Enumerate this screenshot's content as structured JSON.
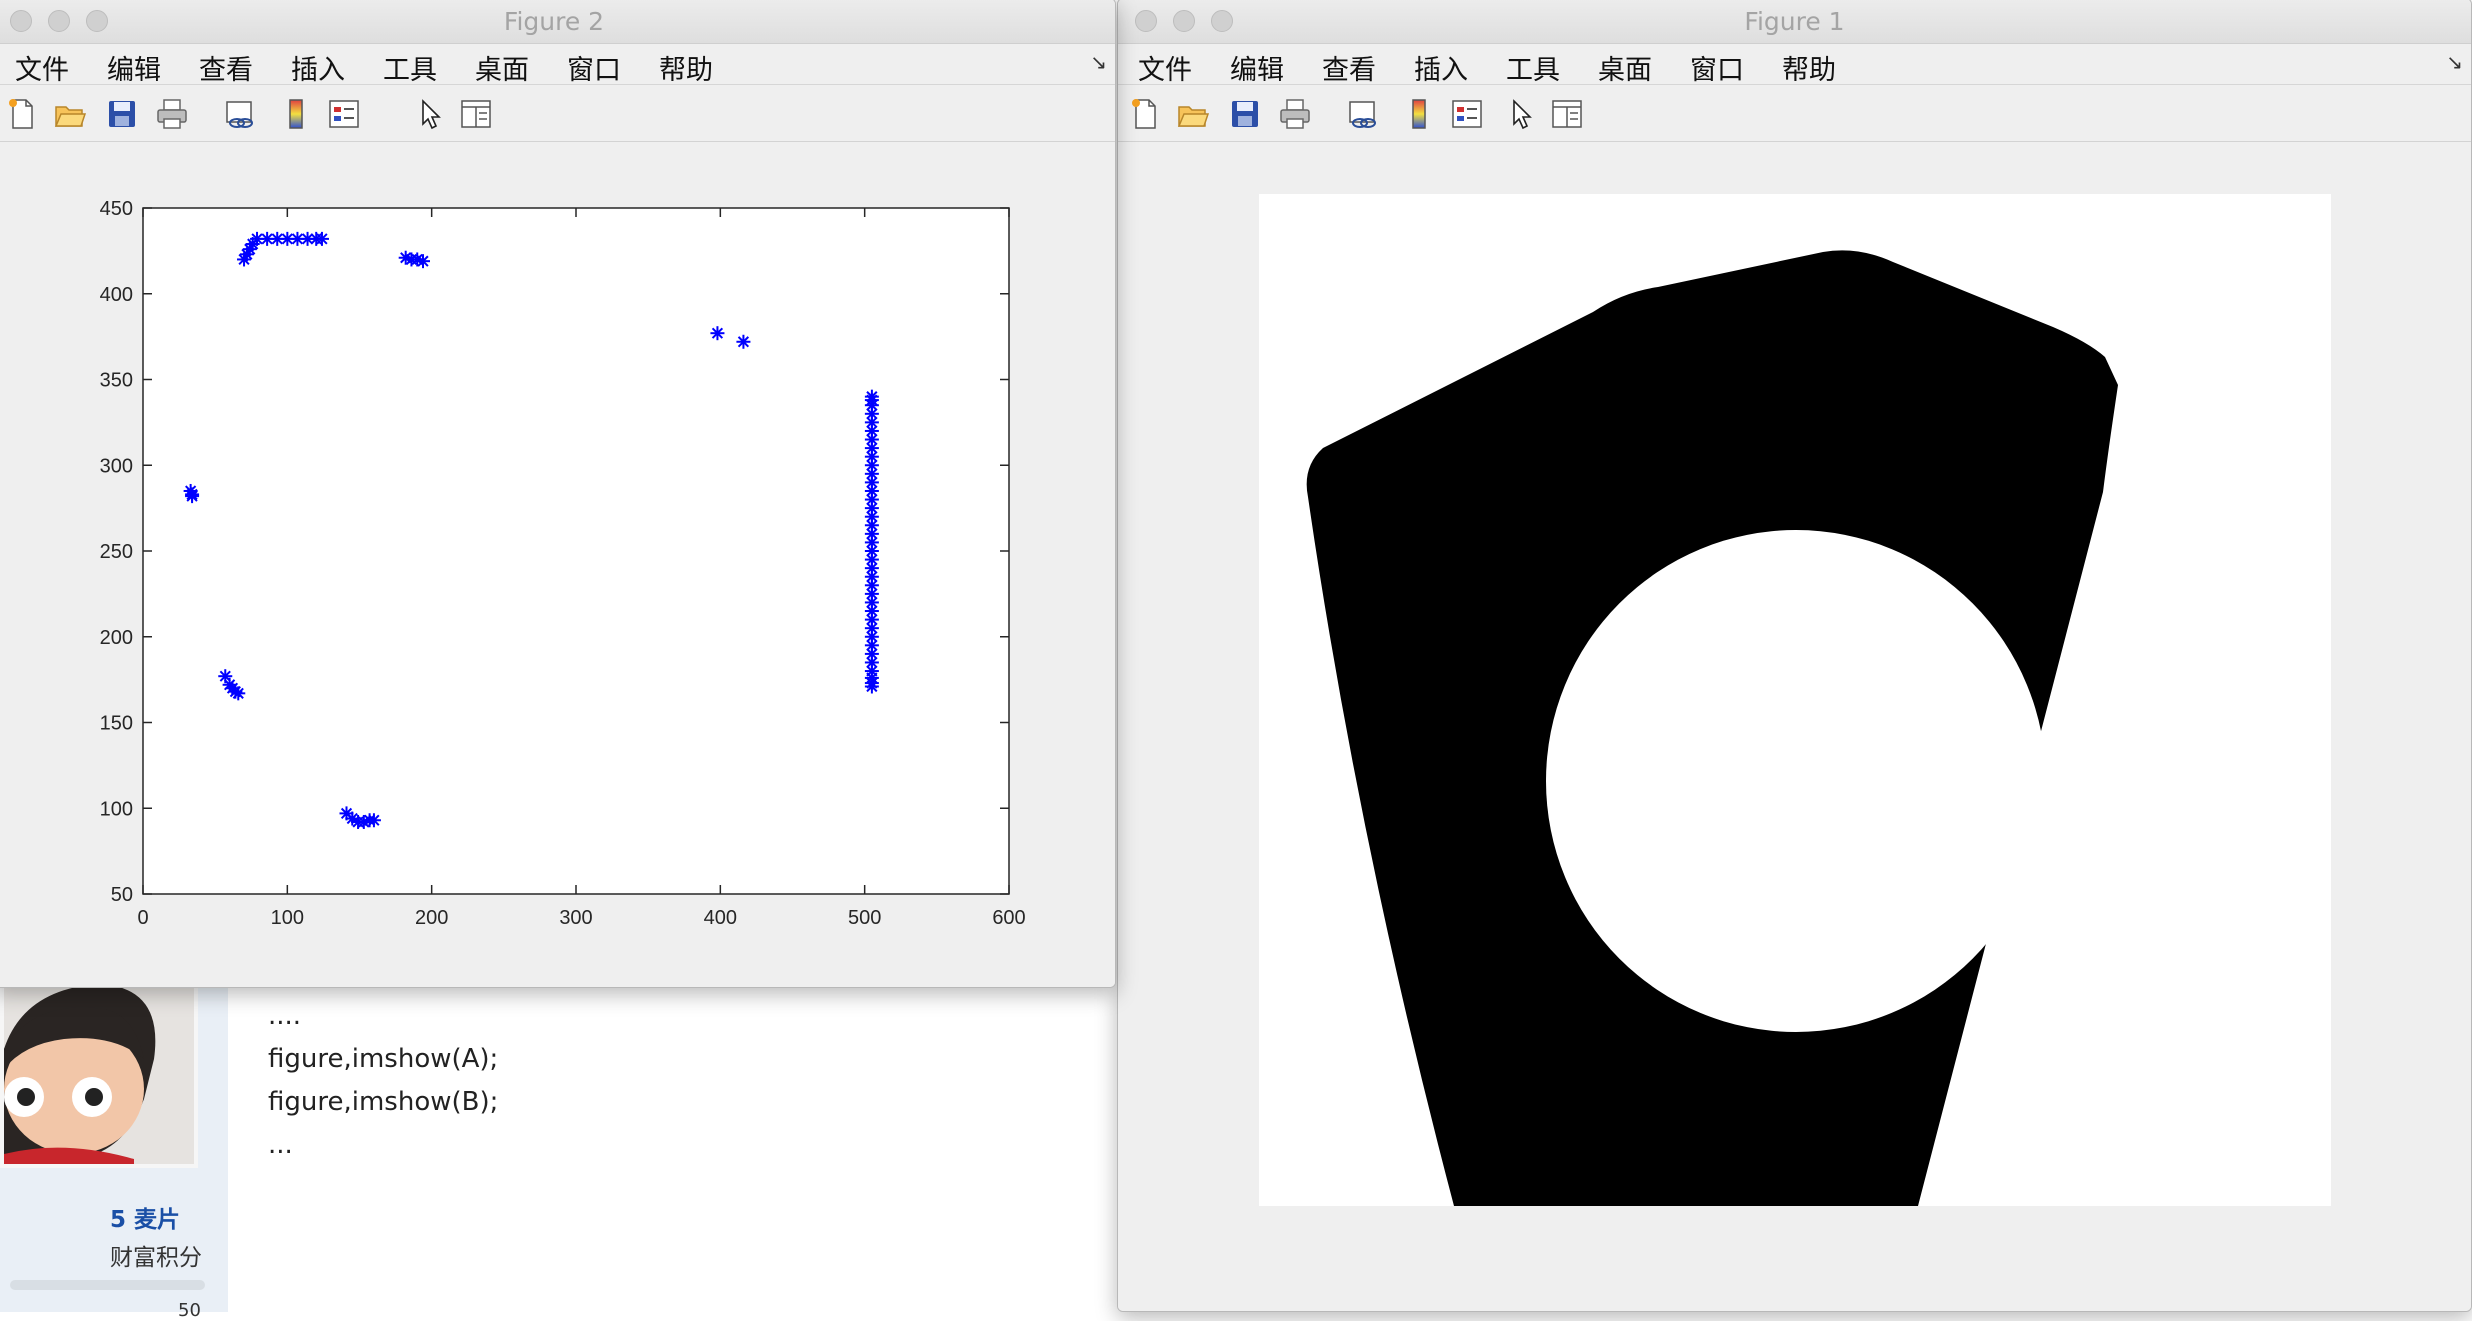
{
  "background_page": {
    "code_lines": [
      "....",
      "figure,imshow(A);",
      "figure,imshow(B);",
      "..."
    ],
    "points_value": "5 麦片",
    "points_label": "财富积分",
    "small_number": "50"
  },
  "figure2": {
    "title": "Figure 2",
    "menu": [
      "文件",
      "编辑",
      "查看",
      "插入",
      "工具",
      "桌面",
      "窗口",
      "帮助"
    ],
    "toolbar_icons": [
      "new-file-icon",
      "open-folder-icon",
      "save-icon",
      "print-icon",
      "link-plot-icon",
      "colorbar-icon",
      "legend-icon",
      "pointer-icon",
      "property-inspector-icon"
    ],
    "marker_color": "#0000ff"
  },
  "figure1": {
    "title": "Figure 1",
    "menu": [
      "文件",
      "编辑",
      "查看",
      "插入",
      "工具",
      "桌面",
      "窗口",
      "帮助"
    ],
    "toolbar_icons": [
      "new-file-icon",
      "open-folder-icon",
      "save-icon",
      "print-icon",
      "link-plot-icon",
      "colorbar-icon",
      "legend-icon",
      "pointer-icon",
      "property-inspector-icon"
    ],
    "image_description_colors": {
      "shape": "#000000",
      "background": "#ffffff"
    }
  },
  "chart_data": {
    "type": "scatter",
    "marker": "*",
    "color": "#0000ff",
    "xlim": [
      0,
      600
    ],
    "ylim": [
      50,
      450
    ],
    "xticks": [
      0,
      100,
      200,
      300,
      400,
      500,
      600
    ],
    "yticks": [
      50,
      100,
      150,
      200,
      250,
      300,
      350,
      400,
      450
    ],
    "title": "",
    "xlabel": "",
    "ylabel": "",
    "grid": false,
    "series": [
      {
        "x": [
          79,
          86,
          93,
          100,
          107,
          114,
          120,
          124,
          70,
          72,
          74,
          76,
          182,
          186,
          190,
          194,
          398,
          416,
          34,
          33,
          34,
          57,
          60,
          62,
          64,
          66,
          141,
          145,
          149,
          153,
          157,
          160,
          505,
          505,
          505,
          505,
          505,
          505,
          505,
          505,
          505,
          505,
          505,
          505,
          505,
          505,
          505,
          505,
          505,
          505,
          505,
          505,
          505,
          505,
          505,
          505,
          505,
          505,
          505,
          505,
          505,
          505,
          505,
          505,
          505,
          505,
          505,
          505,
          505
        ],
        "y": [
          432,
          432,
          432,
          432,
          432,
          432,
          432,
          432,
          420,
          423,
          426,
          429,
          421,
          420,
          420,
          419,
          377,
          372,
          283,
          285,
          282,
          177,
          172,
          170,
          168,
          167,
          97,
          94,
          92,
          92,
          93,
          93,
          340,
          335,
          330,
          325,
          320,
          315,
          310,
          305,
          300,
          295,
          290,
          285,
          280,
          275,
          270,
          265,
          260,
          255,
          250,
          245,
          240,
          235,
          230,
          225,
          220,
          215,
          210,
          205,
          200,
          195,
          190,
          185,
          180,
          176,
          173,
          171,
          338
        ]
      }
    ]
  }
}
